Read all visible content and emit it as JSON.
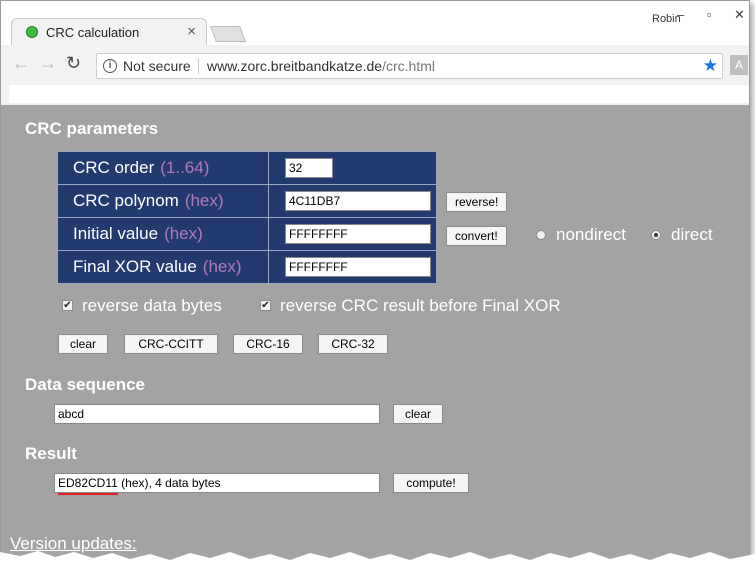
{
  "browser": {
    "tab_title": "CRC calculation",
    "user_name": "Robin",
    "security_label": "Not secure",
    "url_host": "www.zorc.breitbandkatze.de",
    "url_path": "/crc.html"
  },
  "params": {
    "heading": "CRC parameters",
    "order_label": "CRC order",
    "order_hint": "(1..64)",
    "order_value": "32",
    "polynom_label": "CRC polynom",
    "polynom_hint": "(hex)",
    "polynom_value": "4C11DB7",
    "initial_label": "Initial value",
    "initial_hint": "(hex)",
    "initial_value": "FFFFFFFF",
    "final_label": "Final XOR value",
    "final_hint": "(hex)",
    "final_value": "FFFFFFFF",
    "reverse_button": "reverse!",
    "convert_button": "convert!",
    "nondirect_label": "nondirect",
    "direct_label": "direct",
    "nondirect_checked": false,
    "direct_checked": true,
    "reverse_data_label": "reverse data bytes",
    "reverse_crc_label": "reverse CRC result before Final XOR",
    "reverse_data_checked": true,
    "reverse_crc_checked": true
  },
  "presets": {
    "clear": "clear",
    "ccitt": "CRC-CCITT",
    "crc16": "CRC-16",
    "crc32": "CRC-32"
  },
  "data_sequence": {
    "heading": "Data sequence",
    "value": "abcd",
    "clear_button": "clear"
  },
  "result": {
    "heading": "Result",
    "value": "ED82CD11",
    "suffix": " (hex), 4 data bytes",
    "compute_button": "compute!",
    "annotation_color": "#e02020"
  },
  "footer": {
    "version_link": "Version updates:"
  },
  "colors": {
    "page_background": "#a3a3a3",
    "table_background": "#233a6e",
    "hint_color": "#b07ab8",
    "star_color": "#1a73e8"
  }
}
